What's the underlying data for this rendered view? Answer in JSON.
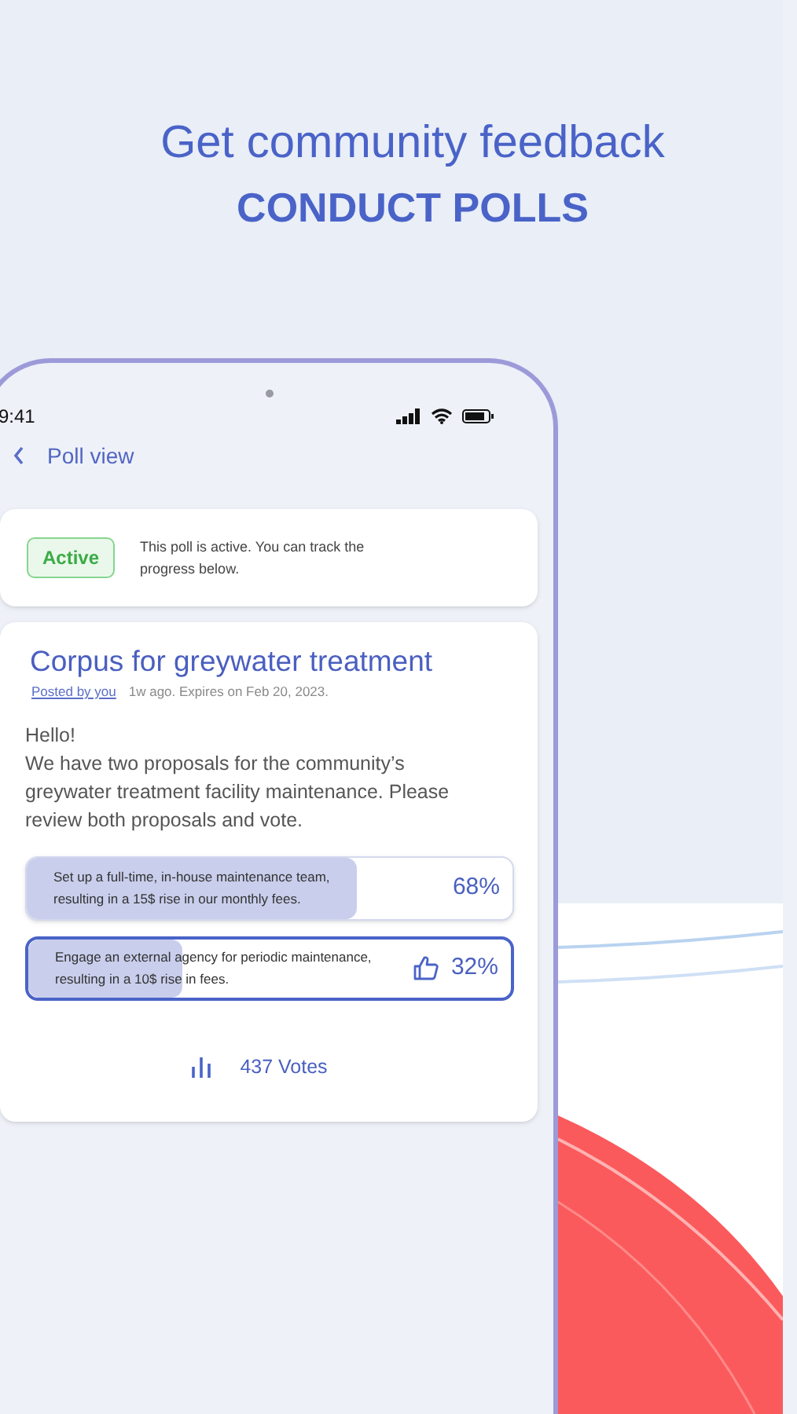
{
  "headline": {
    "line_1": "Get community feedback",
    "line_2": "CONDUCT POLLS"
  },
  "phone": {
    "status_bar": {
      "time": "9:41"
    },
    "nav_title": "Poll view",
    "status_card": {
      "badge": "Active",
      "message": "This poll is active.  You can track the progress below."
    },
    "poll": {
      "title": "Corpus for greywater treatment",
      "author_link": "Posted by you",
      "meta": "1w ago. Expires on Feb 20, 2023.",
      "greeting": "Hello!",
      "body": "We have two proposals for the community’s greywater treatment facility maintenance. Please review both proposals and vote.",
      "options": [
        {
          "text": "Set up a full-time, in-house maintenance team, resulting in a 15$ rise in our monthly fees.",
          "percent": "68%",
          "level": 0.68,
          "selected": false
        },
        {
          "text": "Engage an external agency for periodic maintenance, resulting in a 10$ rise in fees.",
          "percent": "32%",
          "level": 0.32,
          "selected": true
        }
      ],
      "votes": "437 Votes"
    }
  }
}
